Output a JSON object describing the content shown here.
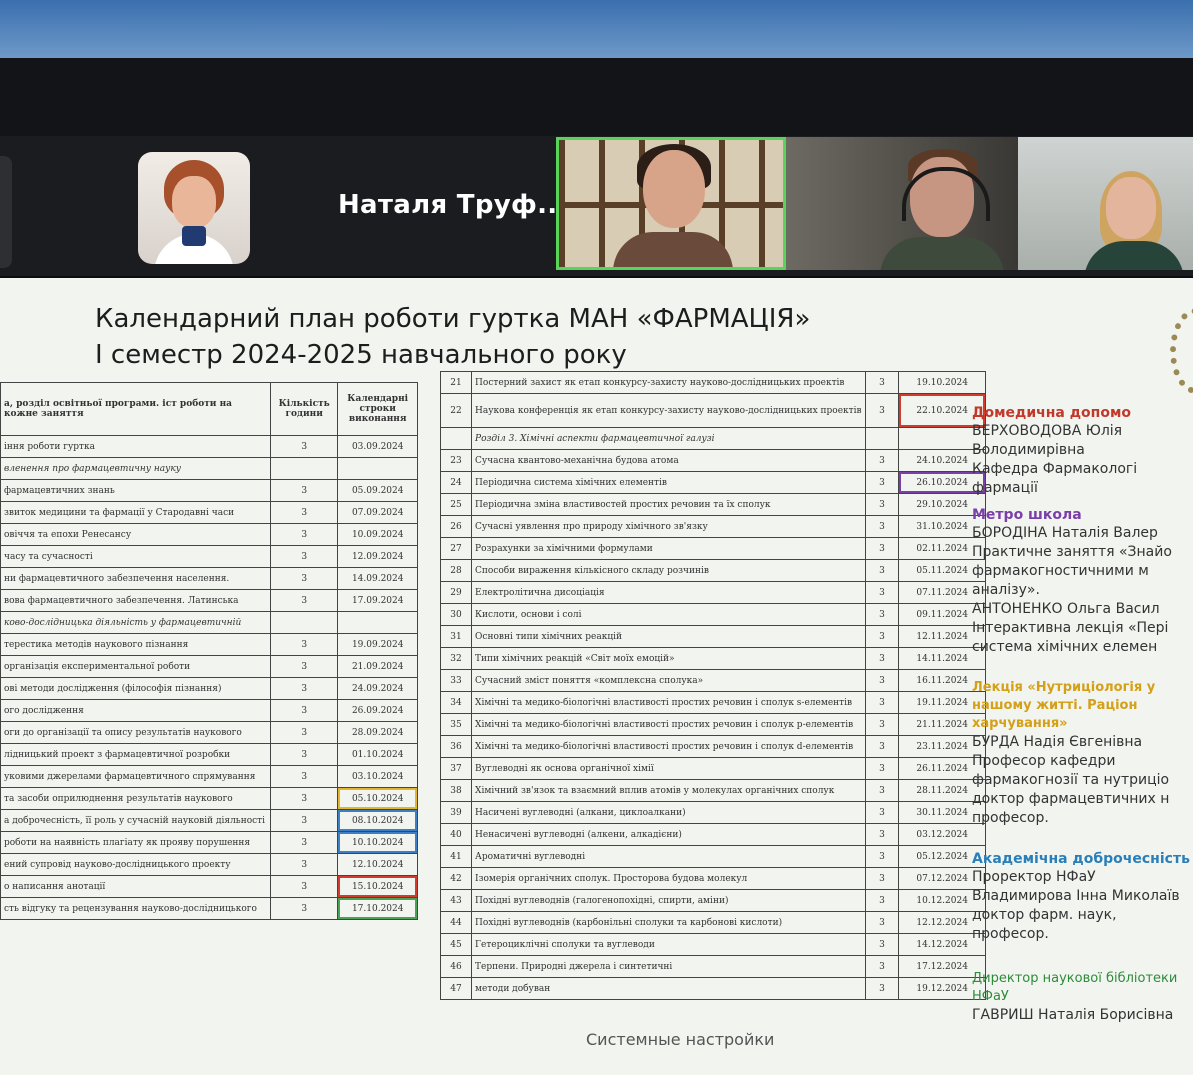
{
  "participants": {
    "name": "Наталя Труф..."
  },
  "slide": {
    "title_line1": "Календарний план роботи гуртка МАН «ФАРМАЦІЯ»",
    "title_line2": "І семестр 2024-2025 навчального року",
    "left_headers": [
      "а, розділ освітньої програми. іст роботи на кожне заняття",
      "Кількість години",
      "Календарні строки виконання"
    ],
    "left_rows": [
      {
        "topic": "іння роботи гуртка",
        "hours": "3",
        "date": "03.09.2024"
      },
      {
        "topic": "вленення про фармацевтичну науку",
        "hours": "",
        "date": ""
      },
      {
        "topic": "фармацевтичних знань",
        "hours": "3",
        "date": "05.09.2024"
      },
      {
        "topic": "звиток медицини та фармації у Стародавні часи",
        "hours": "3",
        "date": "07.09.2024"
      },
      {
        "topic": "овіччя та епохи Ренесансу",
        "hours": "3",
        "date": "10.09.2024"
      },
      {
        "topic": "часу та сучасності",
        "hours": "3",
        "date": "12.09.2024"
      },
      {
        "topic": "ни фармацевтичного забезпечення населення.",
        "hours": "3",
        "date": "14.09.2024"
      },
      {
        "topic": "вова фармацевтичного забезпечення. Латинська",
        "hours": "3",
        "date": "17.09.2024"
      },
      {
        "topic": "ково-дослідницька діяльність у фармацевтичній",
        "hours": "",
        "date": ""
      },
      {
        "topic": "терестика методів наукового пізнання",
        "hours": "3",
        "date": "19.09.2024"
      },
      {
        "topic": "організація експериментальної роботи",
        "hours": "3",
        "date": "21.09.2024"
      },
      {
        "topic": "ові методи дослідження (філософія пізнання)",
        "hours": "3",
        "date": "24.09.2024"
      },
      {
        "topic": "ого дослідження",
        "hours": "3",
        "date": "26.09.2024"
      },
      {
        "topic": "оги до організації та опису результатів наукового",
        "hours": "3",
        "date": "28.09.2024"
      },
      {
        "topic": "лідницький проект з фармацевтичної розробки",
        "hours": "3",
        "date": "01.10.2024"
      },
      {
        "topic": "уковими джерелами фармацевтичного спрямування",
        "hours": "3",
        "date": "03.10.2024"
      },
      {
        "topic": "та засоби оприлюднення результатів наукового",
        "hours": "3",
        "date": "05.10.2024"
      },
      {
        "topic": "а доброчесність, її роль у сучасній науковій діяльності",
        "hours": "3",
        "date": "08.10.2024"
      },
      {
        "topic": "роботи на наявність плагіату як прояву порушення",
        "hours": "3",
        "date": "10.10.2024"
      },
      {
        "topic": "ений супровід науково-дослідницького проекту",
        "hours": "3",
        "date": "12.10.2024"
      },
      {
        "topic": "о написання анотації",
        "hours": "3",
        "date": "15.10.2024"
      },
      {
        "topic": "сть відгуку та рецензування науково-дослідницького",
        "hours": "3",
        "date": "17.10.2024"
      }
    ],
    "right_rows": [
      {
        "n": "21",
        "topic": "Постерний захист як етап конкурсу-захисту науково-дослідницьких проектів",
        "hours": "3",
        "date": "19.10.2024"
      },
      {
        "n": "22",
        "topic": "Наукова конференція як етап конкурсу-захисту науково-дослідницьких проектів",
        "hours": "3",
        "date": "22.10.2024"
      },
      {
        "n": "",
        "topic": "Розділ 3. Хімічні аспекти фармацевтичної галузі",
        "hours": "",
        "date": ""
      },
      {
        "n": "23",
        "topic": "Сучасна квантово-механічна будова атома",
        "hours": "3",
        "date": "24.10.2024"
      },
      {
        "n": "24",
        "topic": "Періодична система хімічних елементів",
        "hours": "3",
        "date": "26.10.2024"
      },
      {
        "n": "25",
        "topic": "Періодична зміна властивостей простих речовин та їх сполук",
        "hours": "3",
        "date": "29.10.2024"
      },
      {
        "n": "26",
        "topic": "Сучасні уявлення про природу хімічного зв'язку",
        "hours": "3",
        "date": "31.10.2024"
      },
      {
        "n": "27",
        "topic": "Розрахунки за хімічними формулами",
        "hours": "3",
        "date": "02.11.2024"
      },
      {
        "n": "28",
        "topic": "Способи вираження кількісного складу розчинів",
        "hours": "3",
        "date": "05.11.2024"
      },
      {
        "n": "29",
        "topic": "Електролітична дисоціація",
        "hours": "3",
        "date": "07.11.2024"
      },
      {
        "n": "30",
        "topic": "Кислоти, основи і солі",
        "hours": "3",
        "date": "09.11.2024"
      },
      {
        "n": "31",
        "topic": "Основні типи хімічних реакцій",
        "hours": "3",
        "date": "12.11.2024"
      },
      {
        "n": "32",
        "topic": "Типи хімічних реакцій «Світ моїх емоцій»",
        "hours": "3",
        "date": "14.11.2024"
      },
      {
        "n": "33",
        "topic": "Сучасний зміст поняття «комплексна сполука»",
        "hours": "3",
        "date": "16.11.2024"
      },
      {
        "n": "34",
        "topic": "Хімічні та медико-біологічні властивості простих речовин і сполук s-елементів",
        "hours": "3",
        "date": "19.11.2024"
      },
      {
        "n": "35",
        "topic": "Хімічні та медико-біологічні властивості простих речовин і сполук p-елементів",
        "hours": "3",
        "date": "21.11.2024"
      },
      {
        "n": "36",
        "topic": "Хімічні та медико-біологічні властивості простих речовин і сполук d-елементів",
        "hours": "3",
        "date": "23.11.2024"
      },
      {
        "n": "37",
        "topic": "Вуглеводні як основа органічної хімії",
        "hours": "3",
        "date": "26.11.2024"
      },
      {
        "n": "38",
        "topic": "Хімічний зв'язок та взаємний вплив атомів у молекулах органічних сполук",
        "hours": "3",
        "date": "28.11.2024"
      },
      {
        "n": "39",
        "topic": "Насичені вуглеводні (алкани, циклоалкани)",
        "hours": "3",
        "date": "30.11.2024"
      },
      {
        "n": "40",
        "topic": "Ненасичені вуглеводні (алкени, алкадієни)",
        "hours": "3",
        "date": "03.12.2024"
      },
      {
        "n": "41",
        "topic": "Ароматичні вуглеводні",
        "hours": "3",
        "date": "05.12.2024"
      },
      {
        "n": "42",
        "topic": "Ізомерія органічних сполук. Просторова будова молекул",
        "hours": "3",
        "date": "07.12.2024"
      },
      {
        "n": "43",
        "topic": "Похідні вуглеводнів (галогенопохідні, спирти, аміни)",
        "hours": "3",
        "date": "10.12.2024"
      },
      {
        "n": "44",
        "topic": "Похідні вуглеводнів (карбонільні сполуки та карбонові кислоти)",
        "hours": "3",
        "date": "12.12.2024"
      },
      {
        "n": "45",
        "topic": "Гетероциклічні сполуки та вуглеводи",
        "hours": "3",
        "date": "14.12.2024"
      },
      {
        "n": "46",
        "topic": "Терпени. Природні джерела і синтетичні",
        "hours": "3",
        "date": "17.12.2024"
      },
      {
        "n": "47",
        "topic": "методи добуван",
        "hours": "3",
        "date": "19.12.2024"
      }
    ],
    "system_note": "Системные настройки",
    "right_panel": [
      {
        "title": "Домедична допомо",
        "color": "#c0392b",
        "lines": [
          "ВЕРХОВОДОВА Юлія",
          "Володимирівна",
          "Кафедра Фармакологі",
          "фармації"
        ]
      },
      {
        "title": "Метро школа",
        "color": "#7a3fa8",
        "lines": [
          "БОРОДІНА Наталія Валер",
          "Практичне заняття «Знайо",
          "фармакогностичними м",
          "аналізу».",
          "АНТОНЕНКО Ольга Васил",
          "Інтерактивна лекція «Пері",
          "система хімічних елемен"
        ]
      },
      {
        "title": "Лекція «Нутриціологія у нашому житті. Раціон харчування»",
        "color": "#d4a017",
        "lines": [
          "БУРДА Надія Євгенівна",
          "Професор кафедри",
          "фармакогнозії та нутриціо",
          "доктор фармацевтичних н",
          "професор."
        ]
      },
      {
        "title": "Академічна доброчесність",
        "color": "#2a7fb8",
        "lines": [
          "Проректор НФаУ",
          "Владимирова Інна Миколаїв",
          "доктор фарм. наук,",
          "професор."
        ]
      },
      {
        "title": "Директор наукової бібліотеки НФаУ",
        "color": "#2e8b3a",
        "lines": [
          "ГАВРИШ Наталія Борисівна"
        ]
      }
    ]
  }
}
